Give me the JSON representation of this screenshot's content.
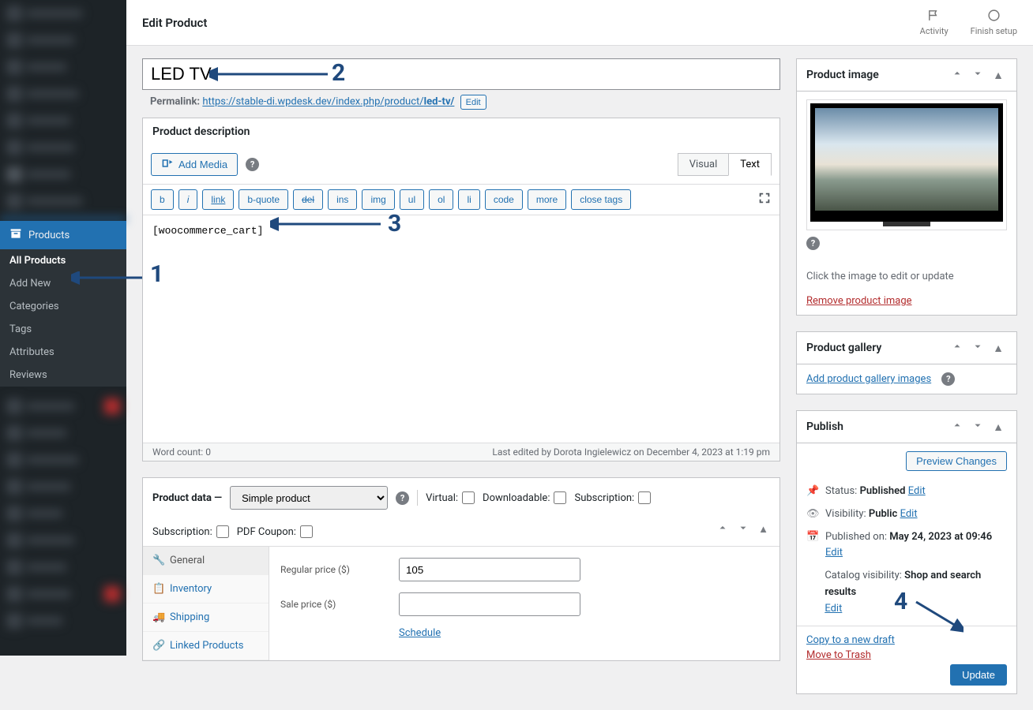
{
  "toolbar": {
    "title": "Edit Product",
    "activity": "Activity",
    "finish": "Finish setup"
  },
  "sidebar": {
    "products_label": "Products",
    "submenu": [
      "All Products",
      "Add New",
      "Categories",
      "Tags",
      "Attributes",
      "Reviews"
    ]
  },
  "title_input": "LED TV",
  "permalink": {
    "label": "Permalink:",
    "base": "https://stable-di.wpdesk.dev/index.php/product/",
    "slug": "led-tv/",
    "edit": "Edit"
  },
  "desc_panel": {
    "title": "Product description",
    "add_media": "Add Media",
    "tabs": {
      "visual": "Visual",
      "text": "Text"
    },
    "qt": [
      "b",
      "i",
      "link",
      "b-quote",
      "del",
      "ins",
      "img",
      "ul",
      "ol",
      "li",
      "code",
      "more",
      "close tags"
    ],
    "content": "[woocommerce_cart]",
    "wordcount_label": "Word count:",
    "wordcount_value": "0",
    "last_edited": "Last edited by Dorota Ingielewicz on December 4, 2023 at 1:19 pm"
  },
  "product_data": {
    "title": "Product data —",
    "type": "Simple product",
    "options": {
      "virtual": "Virtual:",
      "downloadable": "Downloadable:",
      "subscription": "Subscription:",
      "subscription2": "Subscription:",
      "pdf_coupon": "PDF Coupon:"
    },
    "tabs": [
      "General",
      "Inventory",
      "Shipping",
      "Linked Products"
    ],
    "regular_price_label": "Regular price ($)",
    "regular_price": "105",
    "sale_price_label": "Sale price ($)",
    "sale_price": "",
    "schedule": "Schedule"
  },
  "product_image": {
    "title": "Product image",
    "click_text": "Click the image to edit or update",
    "remove": "Remove product image"
  },
  "gallery": {
    "title": "Product gallery",
    "add": "Add product gallery images"
  },
  "publish": {
    "title": "Publish",
    "preview": "Preview Changes",
    "status_label": "Status:",
    "status_value": "Published",
    "edit": "Edit",
    "visibility_label": "Visibility:",
    "visibility_value": "Public",
    "published_label": "Published on:",
    "published_value": "May 24, 2023 at 09:46",
    "catalog_label": "Catalog visibility:",
    "catalog_value": "Shop and search results",
    "copy": "Copy to a new draft",
    "trash": "Move to Trash",
    "update": "Update"
  },
  "annotations": {
    "a1": "1",
    "a2": "2",
    "a3": "3",
    "a4": "4"
  }
}
